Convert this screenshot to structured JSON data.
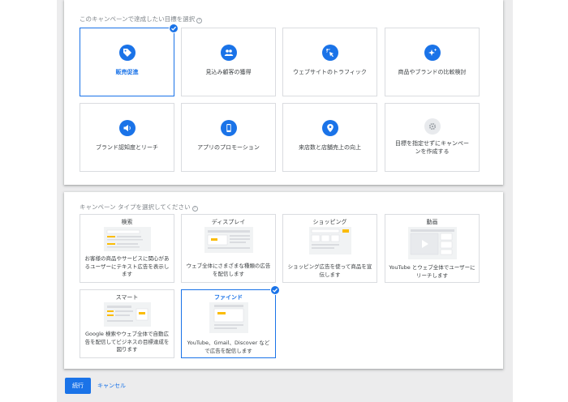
{
  "goal_section": {
    "title": "このキャンペーンで達成したい目標を選択",
    "help": "?",
    "goals": [
      {
        "label": "販売促進",
        "icon": "tag-icon",
        "selected": true
      },
      {
        "label": "見込み顧客の獲得",
        "icon": "people-icon"
      },
      {
        "label": "ウェブサイトのトラフィック",
        "icon": "cursor-click-icon"
      },
      {
        "label": "商品やブランドの比較検討",
        "icon": "sparkle-icon"
      },
      {
        "label": "ブランド認知度とリーチ",
        "icon": "megaphone-icon"
      },
      {
        "label": "アプリのプロモーション",
        "icon": "phone-icon"
      },
      {
        "label": "来店数と店舗売上の向上",
        "icon": "location-pin-icon"
      },
      {
        "label": "目標を指定せずにキャンペーンを作成する",
        "icon": "gear-icon"
      }
    ]
  },
  "type_section": {
    "title": "キャンペーン タイプを選択してください",
    "help": "?",
    "types": [
      {
        "title": "検索",
        "desc": "お客様の商品やサービスに関心があるユーザーにテキスト広告を表示します"
      },
      {
        "title": "ディスプレイ",
        "desc": "ウェブ全体にさまざまな種類の広告を配信します"
      },
      {
        "title": "ショッピング",
        "desc": "ショッピング広告を使って商品を宣伝します"
      },
      {
        "title": "動画",
        "desc": "YouTube とウェブ全体でユーザーにリーチします"
      },
      {
        "title": "スマート",
        "desc": "Google 検索やウェブ全体で自動広告を配信してビジネスの目標達成を図ります"
      },
      {
        "title": "ファインド",
        "desc": "YouTube、Gmail、Discover などで広告を配信します",
        "selected": true
      }
    ]
  },
  "actions": {
    "continue_label": "続行",
    "cancel_label": "キャンセル"
  },
  "colors": {
    "accent": "#1a73e8",
    "background": "#ececed",
    "border": "#dadce0",
    "illustration_highlight": "#fbbc04"
  }
}
